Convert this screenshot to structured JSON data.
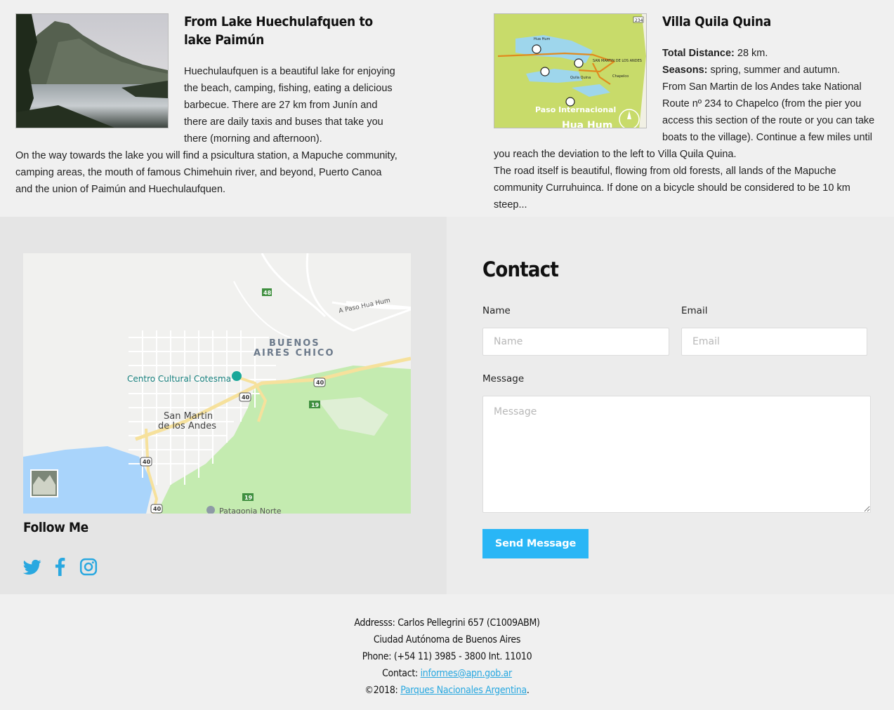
{
  "colors": {
    "accent": "#29b6f6",
    "link": "#29a8e0",
    "panel_left": "#e5e5e5",
    "panel_right": "#ececec"
  },
  "articles": [
    {
      "title": "From Lake Huechulafquen to lake Paimún",
      "image": "lake-photo",
      "paragraphs": [
        "Huechulaufquen is a beautiful lake for enjoying the beach, camping, fishing, eating a delicious barbecue. There are 27 km from Junín and there are daily taxis and buses that take you there (morning and afternoon).",
        "On the way towards the lake you will find a psicultura station, a Mapuche community, camping areas, the mouth of famous Chimehuin river, and beyond, Puerto Canoa and the union of Paimún and Huechulaufquen."
      ]
    },
    {
      "title": "Villa Quila Quina",
      "image": "route-map",
      "distance_label": "Total Distance:",
      "distance_value": " 28 km.",
      "seasons_label": "Seasons:",
      "seasons_value": " spring, summer and autumn.",
      "paragraphs": [
        "From San Martin de los Andes take National Route nº 234 to Chapelco (from the pier you access this section of the route or you can take boats to the village). Continue a few miles until you reach the deviation to the left to Villa Quila Quina.",
        "The road itself is beautiful, flowing from old forests, all lands of the Mapuche community Curruhuinca. If done on a bicycle should be considered to be 10 km steep..."
      ],
      "map_labels": {
        "paso": "Paso Internacional",
        "huahum": "Hua Hum",
        "sma": "SAN MARTIN DE LOS ANDES",
        "chapelco": "Chapelco",
        "quilaquina": "Quila Quina",
        "hua_hum_small": "Hua Hum",
        "route": "234"
      }
    }
  ],
  "map": {
    "labels": {
      "area": "BUENOS",
      "area2": "AIRES CHICO",
      "city": "San Martin",
      "city2": "de los Andes",
      "poi": "Centro Cultural Cotesma",
      "road": "A Paso Hua Hum",
      "poi2": "Patagonia Norte"
    },
    "route_badges": [
      "48",
      "40",
      "40",
      "19",
      "40",
      "19",
      "40"
    ]
  },
  "follow": {
    "title": "Follow Me",
    "icons": [
      "twitter-icon",
      "facebook-icon",
      "instagram-icon"
    ]
  },
  "contact": {
    "title": "Contact",
    "name_label": "Name",
    "name_placeholder": "Name",
    "email_label": "Email",
    "email_placeholder": "Email",
    "message_label": "Message",
    "message_placeholder": "Message",
    "send_label": "Send Message"
  },
  "footer": {
    "address": "Addresss: Carlos Pellegrini 657 (C1009ABM)",
    "city": "Ciudad Autónoma de Buenos Aires",
    "phone": "Phone: (+54 11) 3985 - 3800 Int. 11010",
    "contact_label": "Contact: ",
    "contact_email": "informes@apn.gob.ar",
    "copyright_prefix": "©2018: ",
    "copyright_link": "Parques Nacionales Argentina",
    "copyright_suffix": "."
  }
}
